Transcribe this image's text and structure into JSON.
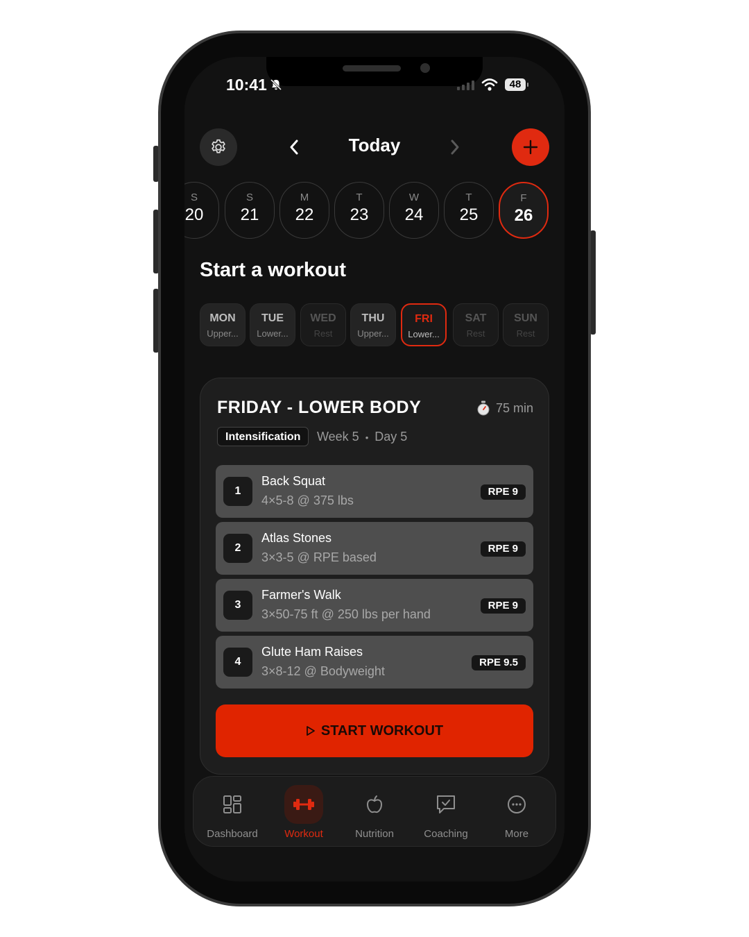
{
  "status": {
    "time": "10:41",
    "battery": "48"
  },
  "header": {
    "title": "Today"
  },
  "dates": [
    {
      "dow": "S",
      "num": "20"
    },
    {
      "dow": "S",
      "num": "21"
    },
    {
      "dow": "M",
      "num": "22"
    },
    {
      "dow": "T",
      "num": "23"
    },
    {
      "dow": "W",
      "num": "24"
    },
    {
      "dow": "T",
      "num": "25"
    },
    {
      "dow": "F",
      "num": "26"
    }
  ],
  "section_title": "Start a workout",
  "week_days": [
    {
      "day": "MON",
      "sub": "Upper..."
    },
    {
      "day": "TUE",
      "sub": "Lower..."
    },
    {
      "day": "WED",
      "sub": "Rest"
    },
    {
      "day": "THU",
      "sub": "Upper..."
    },
    {
      "day": "FRI",
      "sub": "Lower..."
    },
    {
      "day": "SAT",
      "sub": "Rest"
    },
    {
      "day": "SUN",
      "sub": "Rest"
    }
  ],
  "workout": {
    "title": "FRIDAY - LOWER BODY",
    "duration": "75 min",
    "phase": "Intensification",
    "week": "Week 5",
    "day": "Day 5",
    "separator": "•",
    "exercises": [
      {
        "num": "1",
        "name": "Back Squat",
        "detail": "4×5-8 @ 375 lbs",
        "rpe": "RPE 9"
      },
      {
        "num": "2",
        "name": "Atlas Stones",
        "detail": "3×3-5 @ RPE based",
        "rpe": "RPE 9"
      },
      {
        "num": "3",
        "name": "Farmer's Walk",
        "detail": "3×50-75 ft @ 250 lbs per hand",
        "rpe": "RPE 9"
      },
      {
        "num": "4",
        "name": "Glute Ham Raises",
        "detail": "3×8-12 @ Bodyweight",
        "rpe": "RPE 9.5"
      }
    ],
    "start_label": "START WORKOUT"
  },
  "nav": {
    "items": [
      {
        "label": "Dashboard",
        "icon": "dashboard-icon"
      },
      {
        "label": "Workout",
        "icon": "dumbbell-icon"
      },
      {
        "label": "Nutrition",
        "icon": "apple-icon"
      },
      {
        "label": "Coaching",
        "icon": "message-check-icon"
      },
      {
        "label": "More",
        "icon": "more-icon"
      }
    ]
  },
  "colors": {
    "accent": "#e02a10",
    "background": "#121212",
    "card": "#1e1e1e",
    "row": "#4e4e4e"
  }
}
